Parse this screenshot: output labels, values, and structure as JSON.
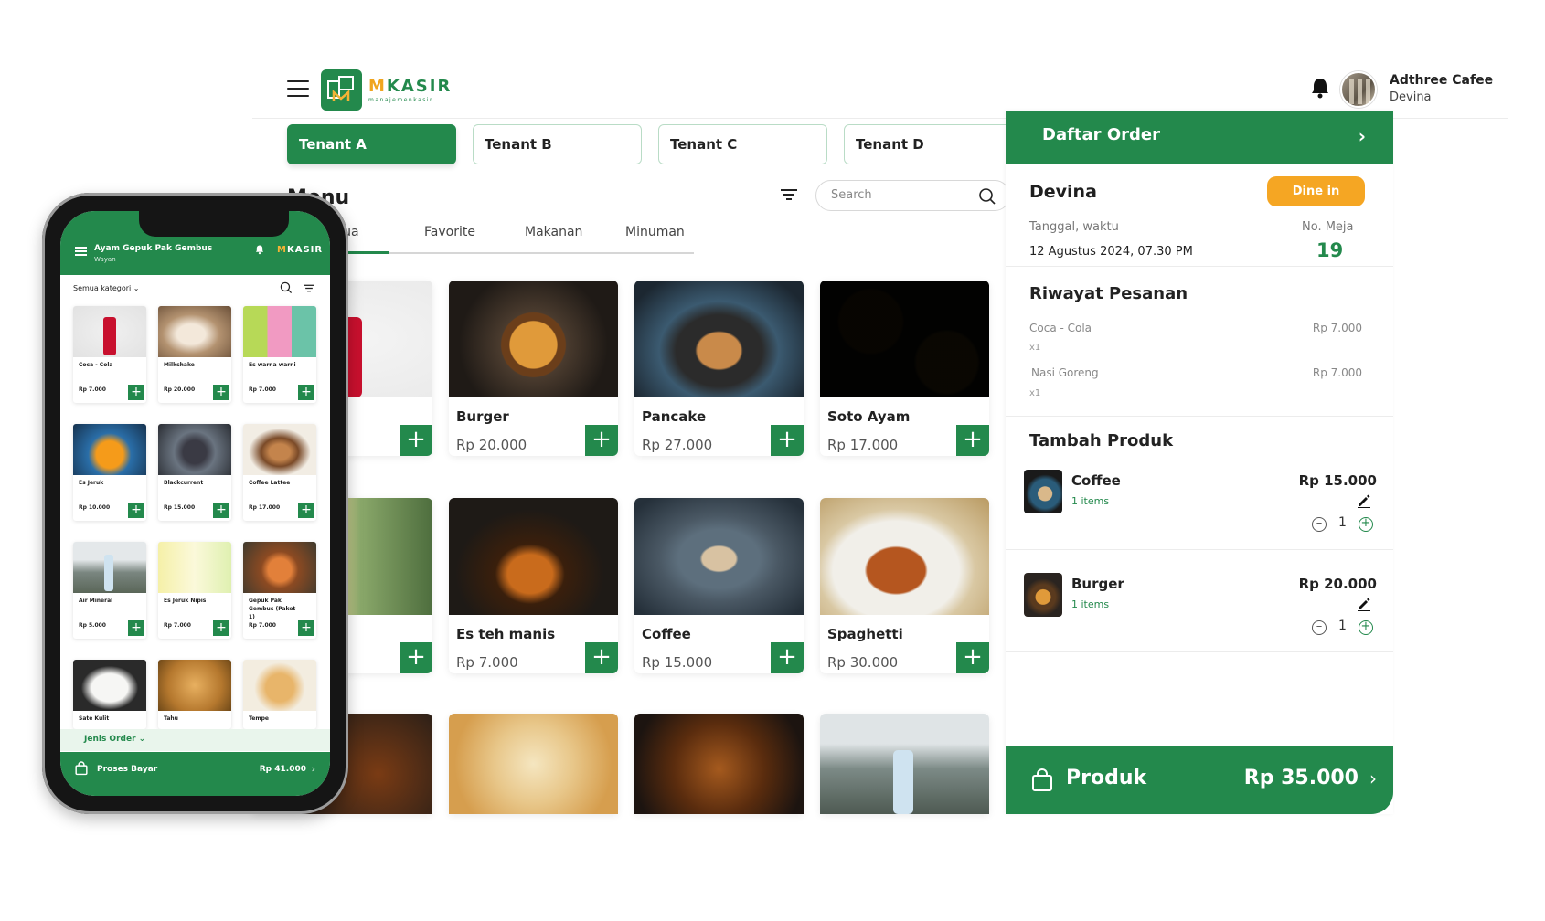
{
  "app": {
    "logo": {
      "word_accent": "M",
      "word_rest": "KASIR",
      "tagline": "manajemenkasir"
    },
    "user": {
      "name": "Adthree Cafee",
      "role": "Devina"
    },
    "tenants": [
      "Tenant A",
      "Tenant B",
      "Tenant C",
      "Tenant D"
    ],
    "menu_title": "Menu",
    "search": {
      "placeholder": "Search"
    },
    "categories": [
      "Semua",
      "Favorite",
      "Makanan",
      "Minuman"
    ],
    "products": [
      {
        "name": "Burger",
        "price": "Rp 20.000"
      },
      {
        "name": "Pancake",
        "price": "Rp 27.000"
      },
      {
        "name": "Soto Ayam",
        "price": "Rp 17.000"
      },
      {
        "name": "Es teh manis",
        "price": "Rp 7.000"
      },
      {
        "name": "Coffee",
        "price": "Rp 15.000"
      },
      {
        "name": "Spaghetti",
        "price": "Rp 30.000"
      }
    ],
    "add_symbol": "+",
    "colors": {
      "primary": "#23894c",
      "accent": "#f5a623"
    }
  },
  "order": {
    "title": "Daftar Order",
    "customer": "Devina",
    "order_type": "Dine in",
    "date_label": "Tanggal, waktu",
    "date_value": "12 Agustus 2024,  07.30 PM",
    "table_label": "No. Meja",
    "table_value": "19",
    "history_title": "Riwayat Pesanan",
    "history": [
      {
        "name": "Coca - Cola",
        "qty": "x1",
        "price": "Rp 7.000"
      },
      {
        "name": "Nasi Goreng",
        "qty": "x1",
        "price": "Rp 7.000"
      }
    ],
    "add_title": "Tambah Produk",
    "items": [
      {
        "name": "Coffee",
        "count": "1 items",
        "price": "Rp 15.000",
        "qty": "1"
      },
      {
        "name": "Burger",
        "count": "1 items",
        "price": "Rp 20.000",
        "qty": "1"
      }
    ],
    "footer": {
      "label": "Produk",
      "total": "Rp 35.000"
    }
  },
  "phone": {
    "store_name": "Ayam Gepuk Pak Gembus",
    "staff": "Wayan",
    "logo_accent": "M",
    "logo_rest": "KASIR",
    "category_select": "Semua kategori",
    "products": [
      {
        "name": "Coca - Cola",
        "price": "Rp 7.000"
      },
      {
        "name": "Milkshake",
        "price": "Rp 20.000"
      },
      {
        "name": "Es warna warni",
        "price": "Rp 7.000"
      },
      {
        "name": "Es Jeruk",
        "price": "Rp 10.000"
      },
      {
        "name": "Blackcurrent",
        "price": "Rp 15.000"
      },
      {
        "name": "Coffee Lattee",
        "price": "Rp 17.000"
      },
      {
        "name": "Air Mineral",
        "price": "Rp 5.000"
      },
      {
        "name": "Es Jeruk Nipis",
        "price": "Rp 7.000"
      },
      {
        "name": "Gepuk Pak Gembus (Paket 1)",
        "price": "Rp 7.000"
      },
      {
        "name": "Sate Kulit",
        "price": ""
      },
      {
        "name": "Tahu",
        "price": ""
      },
      {
        "name": "Tempe",
        "price": ""
      }
    ],
    "order_type_select": "Jenis Order",
    "checkout_label": "Proses Bayar",
    "checkout_total": "Rp 41.000"
  }
}
